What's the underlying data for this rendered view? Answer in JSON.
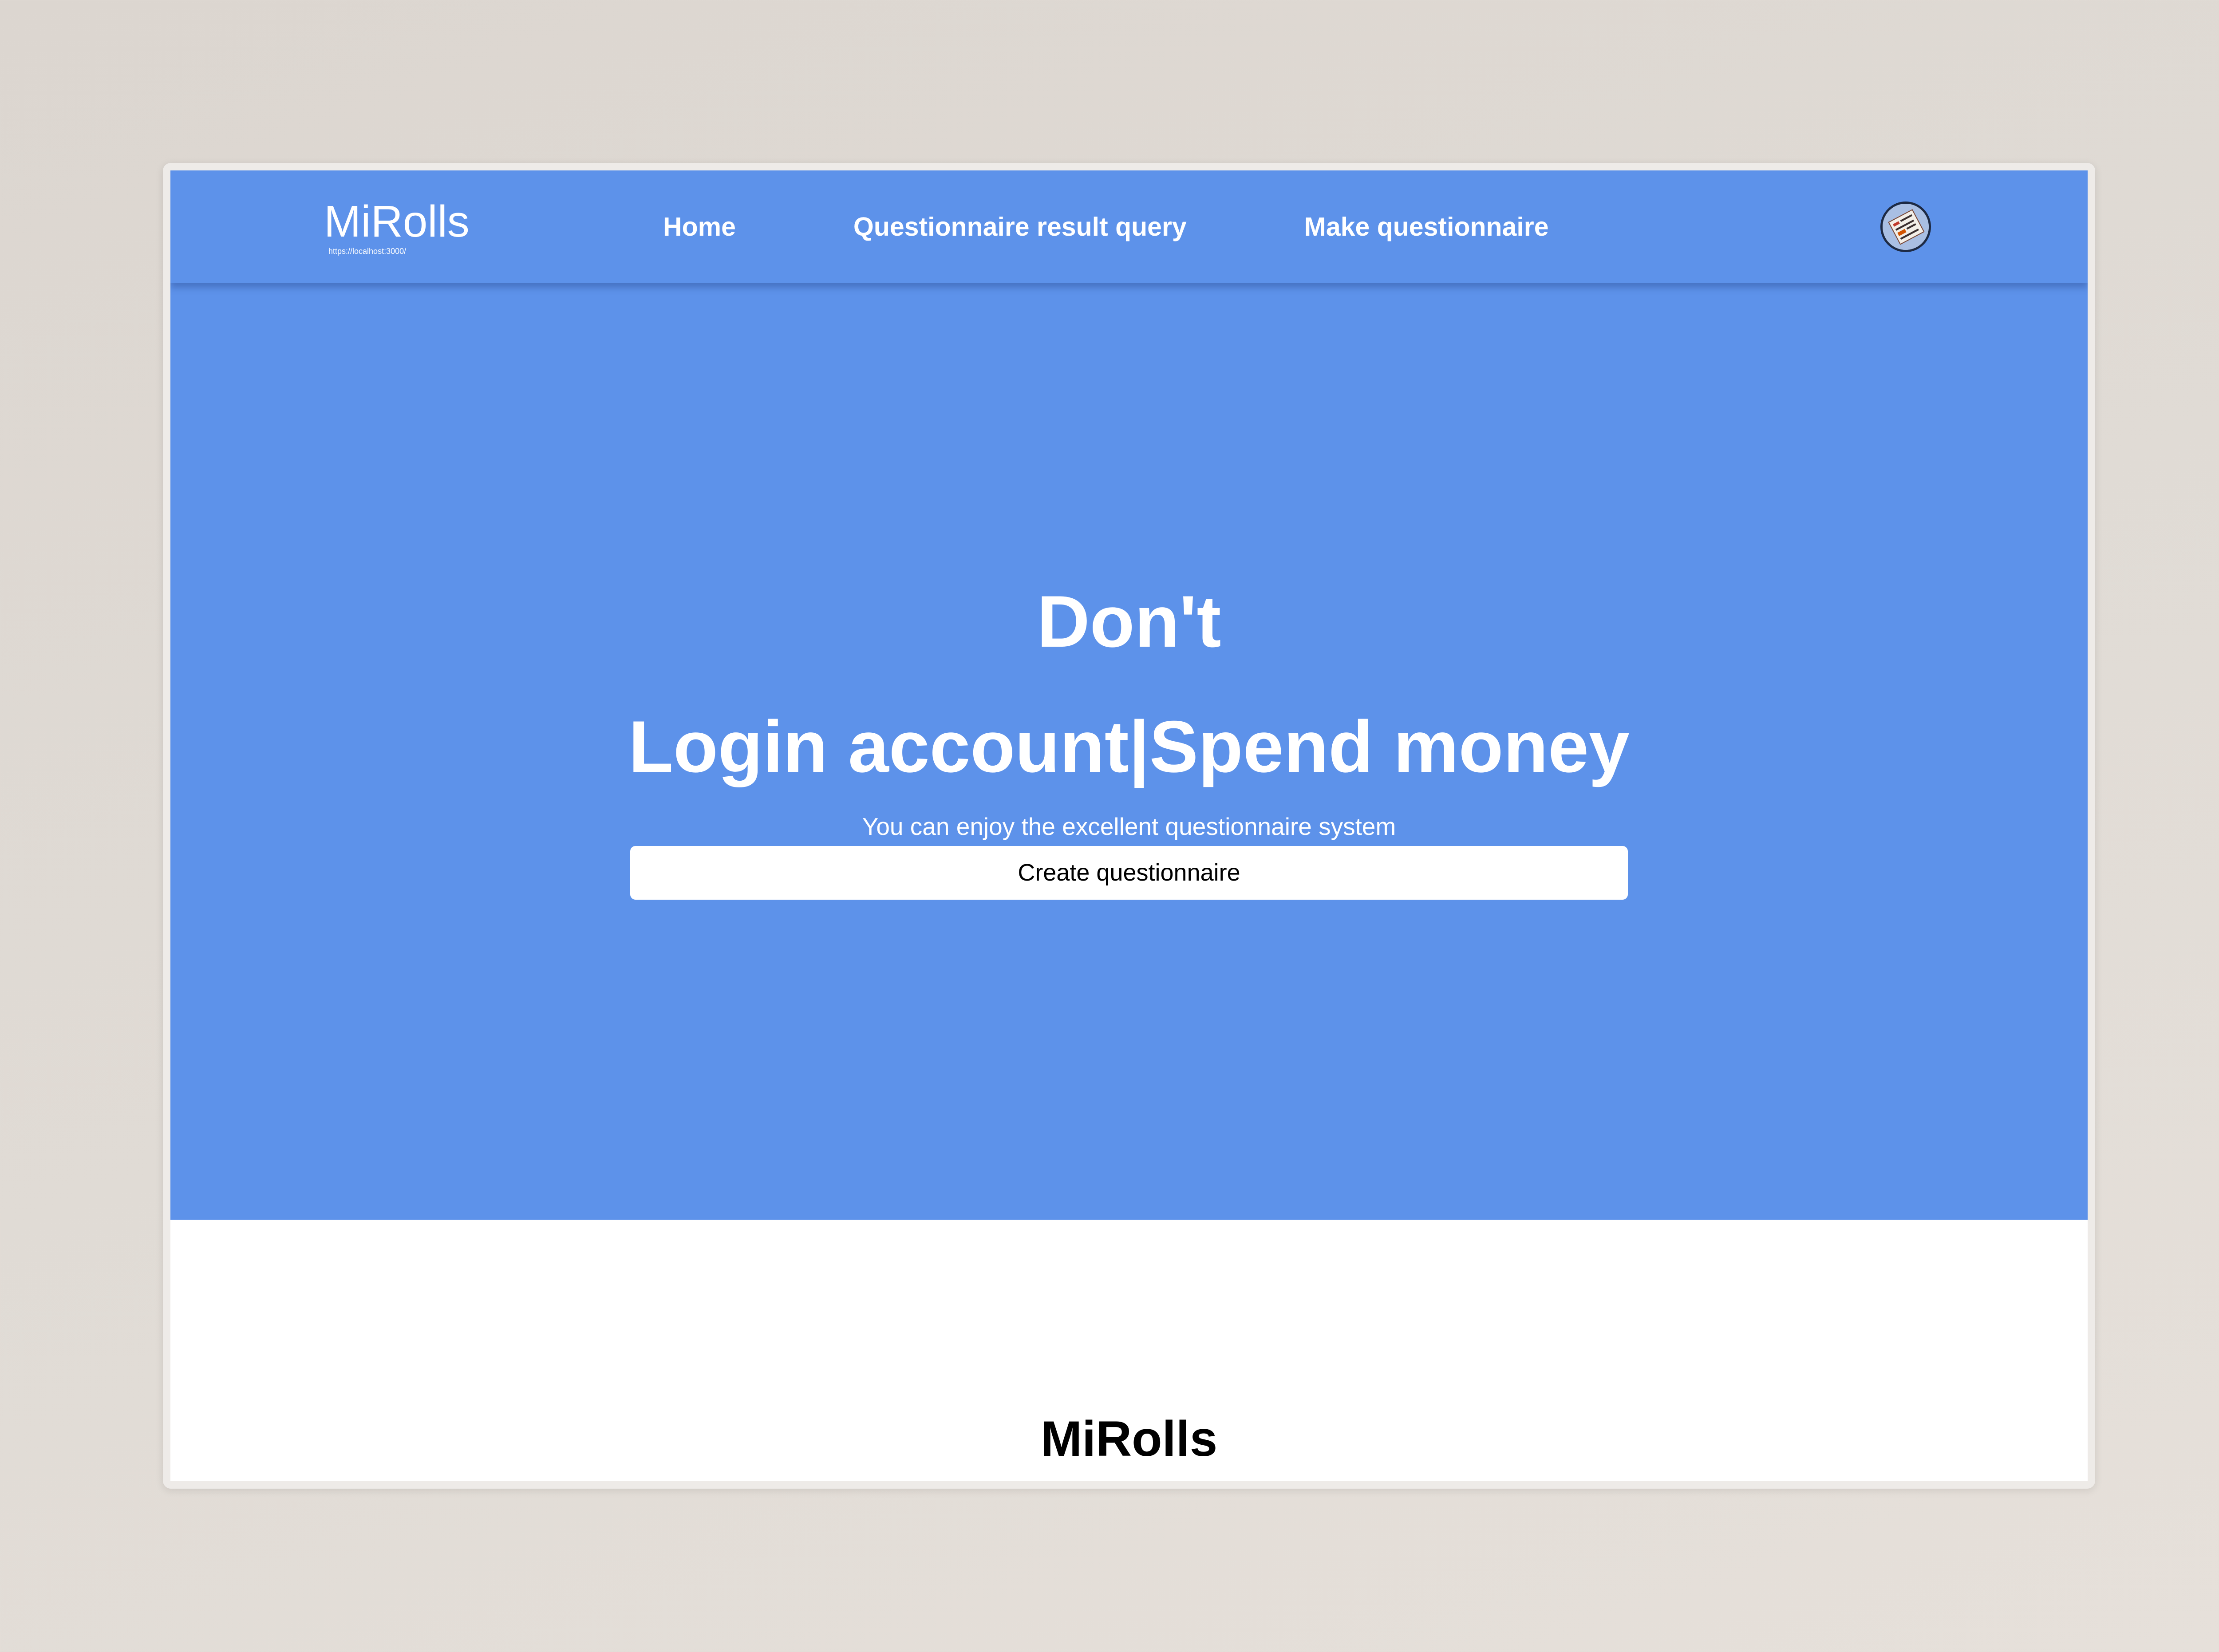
{
  "brand": {
    "name": "MiRolls",
    "url": "https://localhost:3000/"
  },
  "nav": {
    "items": [
      {
        "label": "Home"
      },
      {
        "label": "Questionnaire result query"
      },
      {
        "label": "Make questionnaire"
      }
    ]
  },
  "user": {
    "avatar_icon": "avatar-image"
  },
  "hero": {
    "title_line1": "Don't",
    "title_line2": "Login account|Spend money",
    "subtitle": "You can enjoy the excellent questionnaire system",
    "cta_label": "Create questionnaire"
  },
  "section": {
    "title": "MiRolls"
  },
  "colors": {
    "primary": "#5d92ea",
    "background": "#dcd6d0",
    "text_light": "#ffffff",
    "text_dark": "#000000"
  }
}
